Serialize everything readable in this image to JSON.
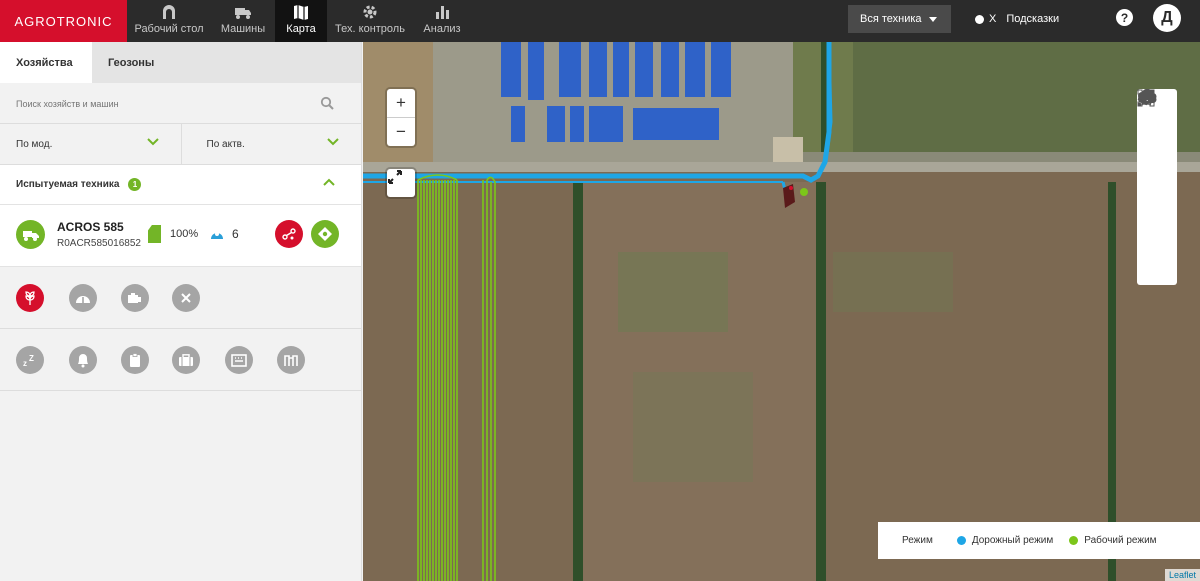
{
  "topbar": {
    "logo": "AGROTRONIC",
    "nav": [
      {
        "label": "Рабочий стол",
        "icon": "dashboard-icon"
      },
      {
        "label": "Машины",
        "icon": "truck-icon"
      },
      {
        "label": "Карта",
        "icon": "map-icon",
        "active": true
      },
      {
        "label": "Тех. контроль",
        "icon": "gear-icon"
      },
      {
        "label": "Анализ",
        "icon": "bar-chart-icon"
      }
    ],
    "vehicle_filter": "Вся техника",
    "hints_toggle": {
      "close_glyph": "X",
      "label": "Подсказки"
    },
    "help_glyph": "?",
    "user_initial": "Д"
  },
  "sidebar": {
    "tabs": [
      {
        "label": "Хозяйства",
        "active": true
      },
      {
        "label": "Геозоны",
        "active": false
      }
    ],
    "search": {
      "placeholder": "Поиск хозяйств и машин"
    },
    "filters": [
      {
        "label": "По мод."
      },
      {
        "label": "По актв."
      }
    ],
    "group": {
      "label": "Испытуемая техника",
      "count": "1"
    },
    "machine": {
      "name": "ACROS 585",
      "id": "R0ACR585016852",
      "fuel": "100%",
      "satellites": "6",
      "icon": "harvester-icon"
    },
    "row1_icons": [
      "grain-icon",
      "speedometer-icon",
      "engine-icon",
      "close-icon"
    ],
    "row2_icons": [
      "sleep-icon",
      "bell-icon",
      "clipboard-icon",
      "briefcase-icon",
      "calendar-icon",
      "header-icon"
    ]
  },
  "map": {
    "zoom_in": "+",
    "zoom_out": "−",
    "legend": {
      "title": "Режим",
      "items": [
        {
          "label": "Дорожный режим",
          "color": "#1ea6e6"
        },
        {
          "label": "Рабочий режим",
          "color": "#7cc61a"
        }
      ]
    },
    "attribution": "Leaflet",
    "colors": {
      "road": "#1ea6e6",
      "work": "#7cc61a",
      "brand": "#d50f2c"
    }
  }
}
